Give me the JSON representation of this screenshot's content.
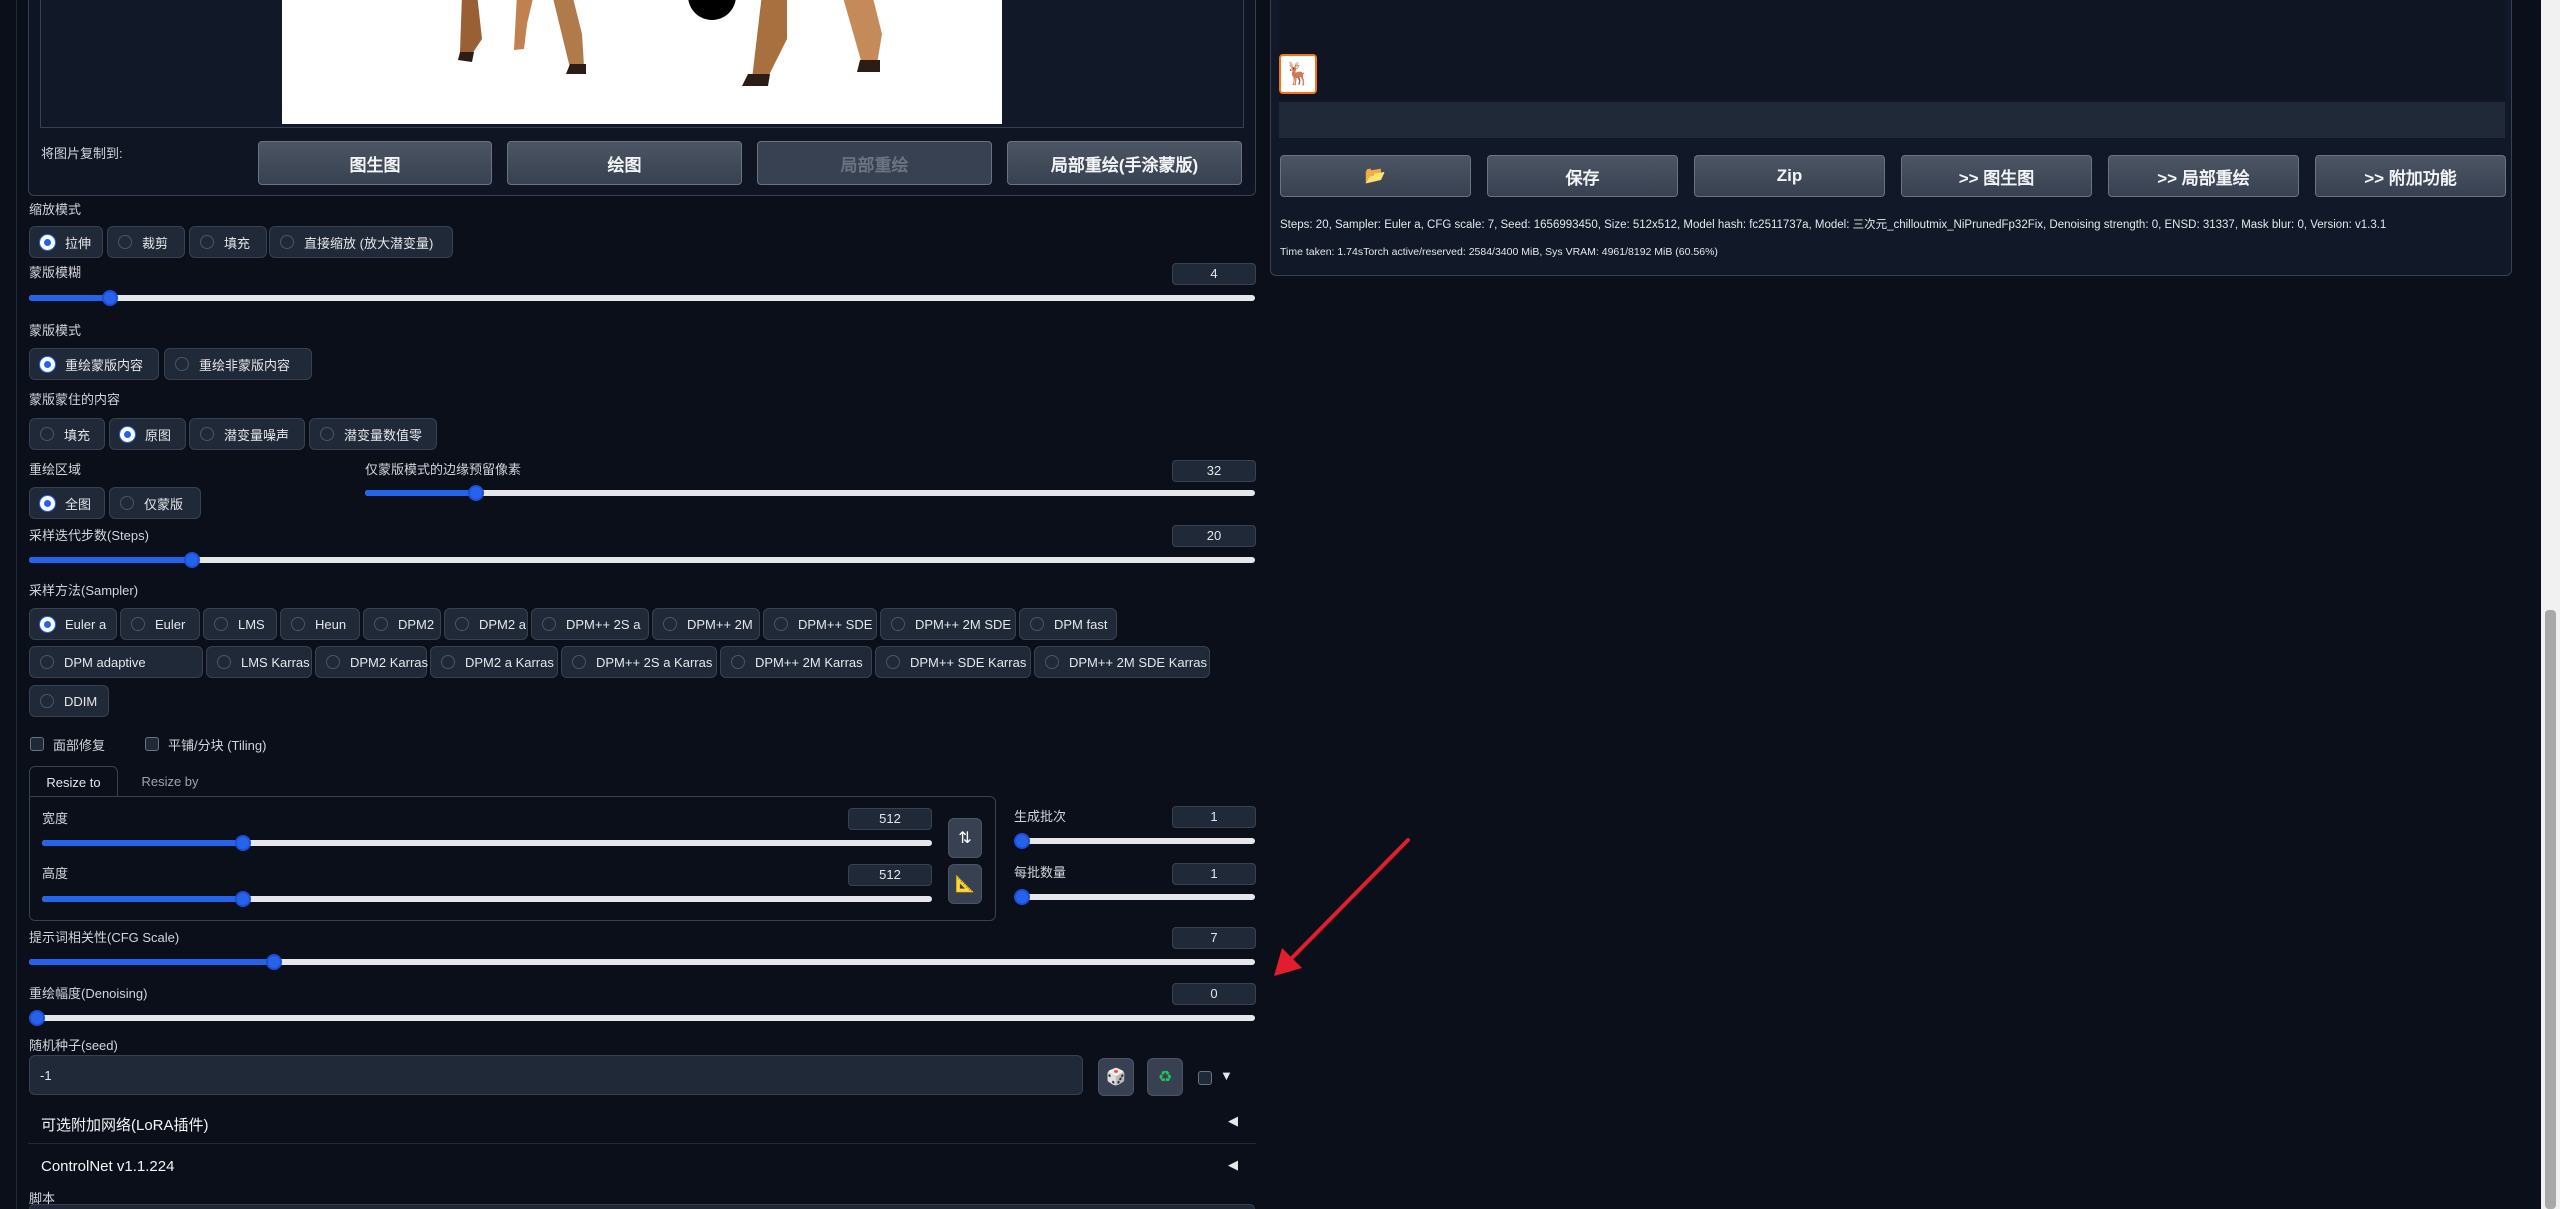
{
  "copy_to": {
    "label": "将图片复制到:",
    "buttons": [
      "图生图",
      "绘图",
      "局部重绘",
      "局部重绘(手涂蒙版)"
    ]
  },
  "resize_mode": {
    "label": "缩放模式",
    "options": [
      "拉伸",
      "裁剪",
      "填充",
      "直接缩放 (放大潜变量)"
    ],
    "selected": "拉伸"
  },
  "mask_blur": {
    "label": "蒙版模糊",
    "value": "4",
    "fraction": 0.066
  },
  "mask_mode": {
    "label": "蒙版模式",
    "options": [
      "重绘蒙版内容",
      "重绘非蒙版内容"
    ],
    "selected": "重绘蒙版内容"
  },
  "masked_content": {
    "label": "蒙版蒙住的内容",
    "options": [
      "填充",
      "原图",
      "潜变量噪声",
      "潜变量数值零"
    ],
    "selected": "原图"
  },
  "inpaint_area": {
    "label": "重绘区域",
    "options": [
      "全图",
      "仅蒙版"
    ],
    "selected": "全图"
  },
  "padding": {
    "label": "仅蒙版模式的边缘预留像素",
    "value": "32",
    "fraction": 0.125
  },
  "steps": {
    "label": "采样迭代步数(Steps)",
    "value": "20",
    "fraction": 0.133
  },
  "sampler": {
    "label": "采样方法(Sampler)",
    "row1": [
      "Euler a",
      "Euler",
      "LMS",
      "Heun",
      "DPM2",
      "DPM2 a",
      "DPM++ 2S a",
      "DPM++ 2M",
      "DPM++ SDE",
      "DPM++ 2M SDE",
      "DPM fast"
    ],
    "row2": [
      "DPM adaptive",
      "LMS Karras",
      "DPM2 Karras",
      "DPM2 a Karras",
      "DPM++ 2S a Karras",
      "DPM++ 2M Karras",
      "DPM++ SDE Karras",
      "DPM++ 2M SDE Karras"
    ],
    "row3": [
      "DDIM"
    ],
    "selected": "Euler a"
  },
  "checks": {
    "face_restore": "面部修复",
    "tiling": "平铺/分块 (Tiling)"
  },
  "tabs": {
    "resize_to": "Resize to",
    "resize_by": "Resize by"
  },
  "width": {
    "label": "宽度",
    "value": "512",
    "fraction": 0.226
  },
  "height": {
    "label": "高度",
    "value": "512",
    "fraction": 0.226
  },
  "batch_count": {
    "label": "生成批次",
    "value": "1",
    "fraction": 0.0
  },
  "batch_size": {
    "label": "每批数量",
    "value": "1",
    "fraction": 0.0
  },
  "cfg": {
    "label": "提示词相关性(CFG Scale)",
    "value": "7",
    "fraction": 0.2
  },
  "denoise": {
    "label": "重绘幅度(Denoising)",
    "value": "0",
    "fraction": 0.0
  },
  "seed": {
    "label": "随机种子(seed)",
    "value": "-1"
  },
  "accordions": {
    "lora": "可选附加网络(LoRA插件)",
    "controlnet": "ControlNet v1.1.224",
    "script": "脚本"
  },
  "output": {
    "buttons": [
      "📂",
      "保存",
      "Zip",
      ">> 图生图",
      ">> 局部重绘",
      ">> 附加功能"
    ],
    "info_line": "Steps: 20, Sampler: Euler a, CFG scale: 7, Seed: 1656993450, Size: 512x512, Model hash: fc2511737a, Model: 三次元_chilloutmix_NiPrunedFp32Fix, Denoising strength: 0, ENSD: 31337, Mask blur: 0, Version: v1.3.1",
    "time_line": "Time taken: 1.74sTorch active/reserved: 2584/3400 MiB, Sys VRAM: 4961/8192 MiB (60.56%)"
  },
  "colors": {
    "accent": "#2563eb",
    "bg": "#0b0f19",
    "arrow": "#e11d2e"
  }
}
